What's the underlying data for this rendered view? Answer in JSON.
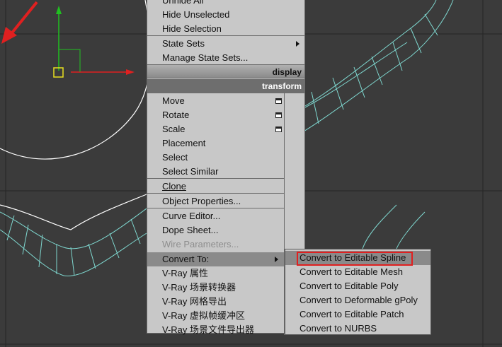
{
  "quad_menu": {
    "items_top": [
      {
        "label": "Unhide All"
      },
      {
        "label": "Hide Unselected"
      },
      {
        "label": "Hide Selection"
      },
      {
        "label": "State Sets"
      },
      {
        "label": "Manage State Sets..."
      }
    ],
    "headers": {
      "display": "display",
      "transform": "transform"
    },
    "transform_items": [
      {
        "label": "Move"
      },
      {
        "label": "Rotate"
      },
      {
        "label": "Scale"
      },
      {
        "label": "Placement"
      },
      {
        "label": "Select"
      },
      {
        "label": "Select Similar"
      },
      {
        "label": "Clone"
      },
      {
        "label": "Object Properties..."
      },
      {
        "label": "Curve Editor..."
      },
      {
        "label": "Dope Sheet..."
      },
      {
        "label": "Wire Parameters..."
      },
      {
        "label": "Convert To:"
      },
      {
        "label": "V-Ray 属性"
      },
      {
        "label": "V-Ray 场景转换器"
      },
      {
        "label": "V-Ray 网格导出"
      },
      {
        "label": "V-Ray 虚拟帧缓冲区"
      },
      {
        "label": "V-Ray 场景文件导出器"
      }
    ]
  },
  "convert_submenu": {
    "items": [
      {
        "label": "Convert to Editable Spline"
      },
      {
        "label": "Convert to Editable Mesh"
      },
      {
        "label": "Convert to Editable Poly"
      },
      {
        "label": "Convert to Deformable gPoly"
      },
      {
        "label": "Convert to Editable Patch"
      },
      {
        "label": "Convert to NURBS"
      }
    ]
  },
  "colors": {
    "viewport_bg": "#3b3b3b",
    "grid": "#2a2a2a",
    "spline": "#ffffff",
    "mesh": "#7fd8d0",
    "annotation": "#e02020",
    "axis_x": "#e02020",
    "axis_y": "#20c020",
    "pivot": "#e8e020"
  },
  "icons": {
    "window_icon": "floating-window-icon",
    "submenu_arrow": "submenu-arrow-icon"
  }
}
